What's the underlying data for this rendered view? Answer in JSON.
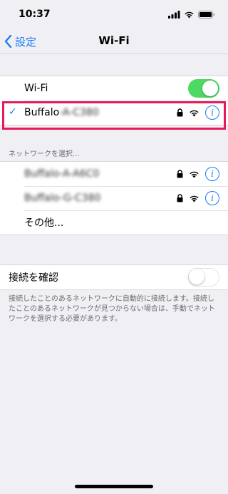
{
  "status_bar": {
    "time": "10:37"
  },
  "nav": {
    "back_label": "設定",
    "title": "Wi-Fi"
  },
  "wifi_toggle": {
    "label": "Wi-Fi",
    "state": "on"
  },
  "connected_network": {
    "name_visible": "Buffalo",
    "name_blurred": "-A-C380"
  },
  "section_header": "ネットワークを選択...",
  "networks": [
    {
      "name": "Buffalo-A-A6C0"
    },
    {
      "name": "Buffalo-G-C380"
    }
  ],
  "other_label": "その他...",
  "ask_to_join": {
    "label": "接続を確認",
    "state": "off"
  },
  "footer": "接続したことのあるネットワークに自動的に接続します。接続したことのあるネットワークが見つからない場合は、手動でネットワークを選択する必要があります。",
  "colors": {
    "accent": "#1a7cf6",
    "toggle_on": "#4cd964",
    "highlight": "#e8195a"
  },
  "icons": [
    "signal-icon",
    "wifi-status-icon",
    "battery-icon",
    "chevron-left-icon",
    "checkmark-icon",
    "lock-icon",
    "wifi-icon",
    "info-icon"
  ]
}
